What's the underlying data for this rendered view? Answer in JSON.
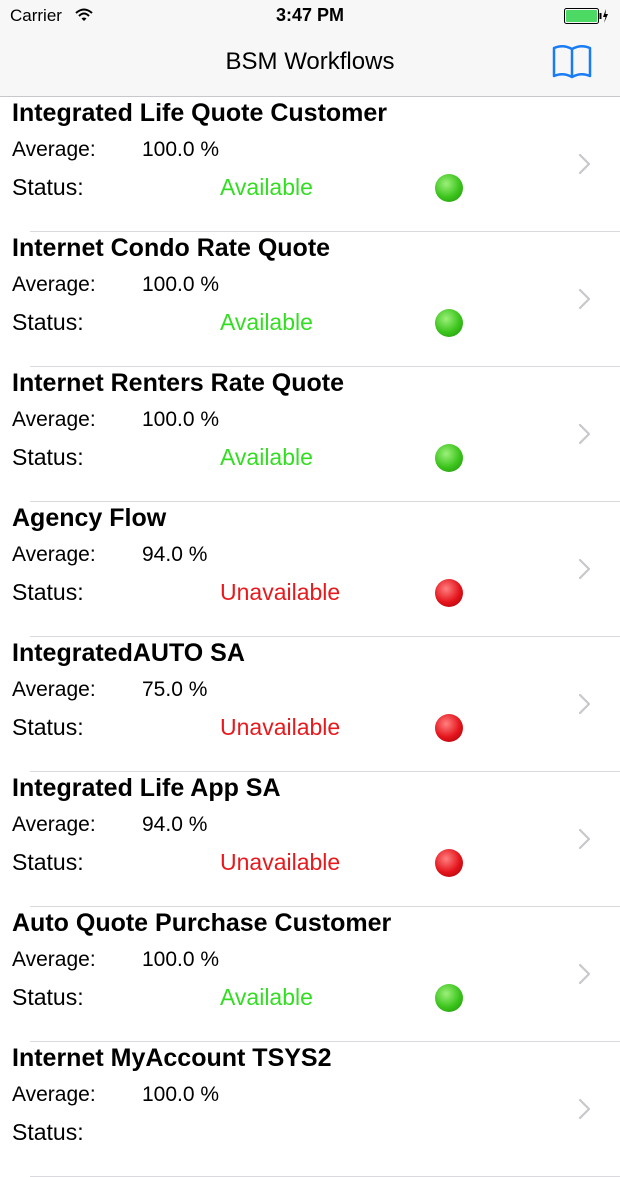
{
  "status_bar": {
    "carrier": "Carrier",
    "time": "3:47 PM",
    "wifi_icon": "wifi-icon",
    "battery_icon": "battery-charging-icon"
  },
  "nav": {
    "title": "BSM Workflows",
    "book_icon": "book-icon"
  },
  "colors": {
    "available": "#33dd22",
    "unavailable": "#e8191c",
    "tint": "#1a7cf5"
  },
  "rows": [
    {
      "title": "Integrated Life Quote Customer",
      "average_label": "Average:",
      "average": "100.0 %",
      "status_label": "Status:",
      "status": "Available",
      "state": "up"
    },
    {
      "title": "Internet Condo Rate Quote",
      "average_label": "Average:",
      "average": "100.0 %",
      "status_label": "Status:",
      "status": "Available",
      "state": "up"
    },
    {
      "title": "Internet Renters Rate Quote",
      "average_label": "Average:",
      "average": "100.0 %",
      "status_label": "Status:",
      "status": "Available",
      "state": "up"
    },
    {
      "title": "Agency Flow",
      "average_label": "Average:",
      "average": "94.0 %",
      "status_label": "Status:",
      "status": "Unavailable",
      "state": "down"
    },
    {
      "title": "IntegratedAUTO SA",
      "average_label": "Average:",
      "average": "75.0 %",
      "status_label": "Status:",
      "status": "Unavailable",
      "state": "down"
    },
    {
      "title": "Integrated Life App SA",
      "average_label": "Average:",
      "average": "94.0 %",
      "status_label": "Status:",
      "status": "Unavailable",
      "state": "down"
    },
    {
      "title": "Auto Quote Purchase Customer",
      "average_label": "Average:",
      "average": "100.0 %",
      "status_label": "Status:",
      "status": "Available",
      "state": "up"
    },
    {
      "title": "Internet MyAccount TSYS2",
      "average_label": "Average:",
      "average": "100.0 %",
      "status_label": "Status:",
      "status": "",
      "state": "none"
    }
  ]
}
